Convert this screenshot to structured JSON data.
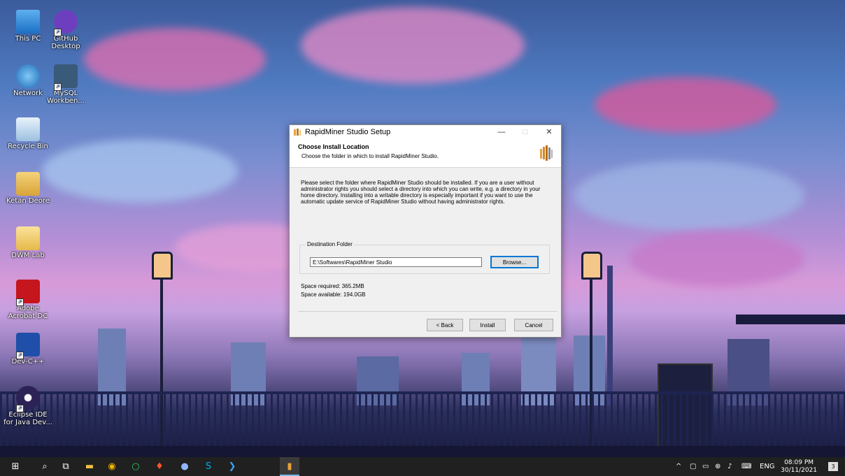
{
  "desktop": {
    "icons": [
      {
        "label": "This PC",
        "icon": "computer-icon"
      },
      {
        "label": "GitHub Desktop",
        "icon": "github-icon"
      },
      {
        "label": "Network",
        "icon": "network-icon"
      },
      {
        "label": "MySQL Workben...",
        "icon": "mysql-icon"
      },
      {
        "label": "Recycle Bin",
        "icon": "recycle-bin-icon"
      },
      {
        "label": "Ketan Deore",
        "icon": "user-folder-icon"
      },
      {
        "label": "DWM Lab",
        "icon": "folder-icon"
      },
      {
        "label": "Adobe Acrobat DC",
        "icon": "acrobat-icon"
      },
      {
        "label": "Dev-C++",
        "icon": "devcpp-icon"
      },
      {
        "label": "Eclipse IDE for Java Dev...",
        "icon": "eclipse-icon"
      }
    ]
  },
  "dialog": {
    "window_title": "RapidMiner Studio Setup",
    "controls": {
      "minimize": "—",
      "maximize": "□",
      "close": "✕"
    },
    "header_title": "Choose Install Location",
    "header_subtitle": "Choose the folder in which to install RapidMiner Studio.",
    "description": "Please select the folder where RapidMiner Studio should be installed. If you are a user without administrator rights you should select a directory into which you can write, e.g. a directory in your home directory. Installing into a writable directory is especially important if you want to use the automatic update service of RapidMiner Studio without having administrator rights.",
    "group_label": "Destination Folder",
    "destination_path": "E:\\Softwares\\RapidMiner Studio",
    "browse_label": "Browse...",
    "space_required": "Space required: 365.2MB",
    "space_available": "Space available: 194.0GB",
    "back_label": "< Back",
    "install_label": "Install",
    "cancel_label": "Cancel"
  },
  "taskbar": {
    "icons": [
      "windows-start-icon",
      "search-icon",
      "task-view-icon",
      "file-explorer-icon",
      "chrome-icon",
      "cortana-icon",
      "brave-icon",
      "messages-icon",
      "skype-icon",
      "vscode-icon",
      "rapidminer-icon"
    ],
    "tray": {
      "chevron": "^",
      "language": "ENG",
      "time": "08:09 PM",
      "date": "30/11/2021",
      "notification_count": "3"
    }
  }
}
